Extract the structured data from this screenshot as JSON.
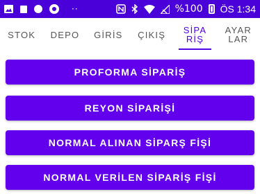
{
  "status_bar": {
    "battery_text": "%100",
    "time": "ÖS 1:34",
    "icons": [
      "image-icon",
      "notification-icon",
      "circle-icon",
      "soccer-ball-icon",
      "more-dots-icon",
      "nfc-icon",
      "bluetooth-icon",
      "wifi-icon",
      "no-signal-icon",
      "battery-icon"
    ]
  },
  "tabs": [
    {
      "label": "STOK",
      "active": false
    },
    {
      "label": "DEPO",
      "active": false
    },
    {
      "label": "GİRİS",
      "active": false
    },
    {
      "label": "ÇIKIŞ",
      "active": false
    },
    {
      "label": "SİPA\nRİŞ",
      "active": true
    },
    {
      "label": "AYAR\nLAR",
      "active": false
    }
  ],
  "buttons": {
    "proforma": "PROFORMA SİPARİŞ",
    "reyon": "REYON SİPARİŞİ",
    "normal_alinan": "NORMAL ALINAN SİPARŞ FİŞİ",
    "normal_verilen": "NORMAL VERİLEN SİPARİŞ FİŞİ"
  },
  "colors": {
    "status_bar": "#4a00d8",
    "primary": "#6200ee",
    "active_tab": "#5200e6"
  }
}
